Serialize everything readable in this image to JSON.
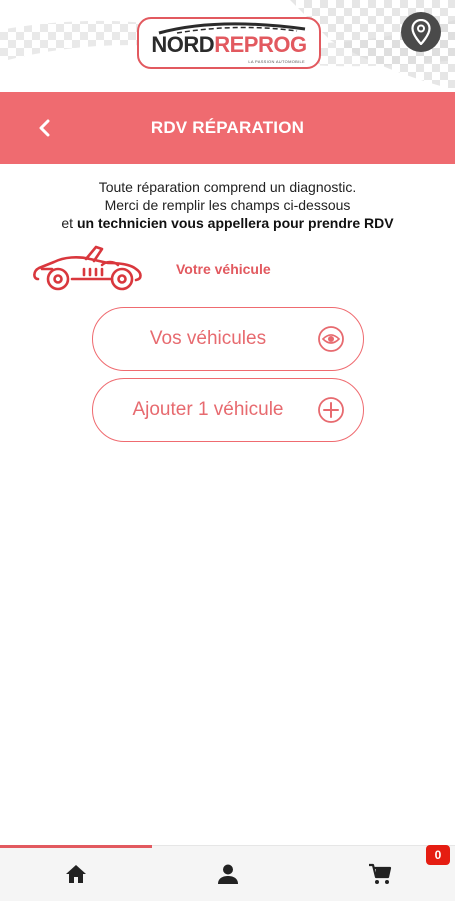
{
  "header": {
    "logo": {
      "brand_part1": "NORD",
      "brand_part2": "REPROG",
      "tagline": "LA PASSION AUTOMOBILE"
    },
    "location_icon": "location-pin-icon"
  },
  "title_bar": {
    "back_icon": "chevron-left-icon",
    "title": "RDV RÉPARATION"
  },
  "intro": {
    "line1": "Toute réparation comprend un diagnostic.",
    "line2": "Merci de remplir les champs ci-dessous",
    "line3_prefix": "et",
    "line3_bold": "un technicien vous appellera pour prendre RDV"
  },
  "vehicle_section": {
    "icon": "car-icon",
    "label": "Votre véhicule"
  },
  "buttons": {
    "my_vehicles": {
      "label": "Vos véhicules",
      "icon": "eye-icon"
    },
    "add_vehicle": {
      "label": "Ajouter 1 véhicule",
      "icon": "plus-circle-icon"
    }
  },
  "bottom_nav": {
    "items": [
      {
        "name": "home",
        "icon": "home-icon",
        "active": true
      },
      {
        "name": "account",
        "icon": "user-icon",
        "active": false
      },
      {
        "name": "cart",
        "icon": "cart-icon",
        "active": false
      }
    ],
    "cart_badge": "0"
  },
  "colors": {
    "accent": "#ef6b70",
    "accent_dark": "#e2595f",
    "badge": "#e51d12",
    "nav_bg": "#f5f5f5"
  }
}
